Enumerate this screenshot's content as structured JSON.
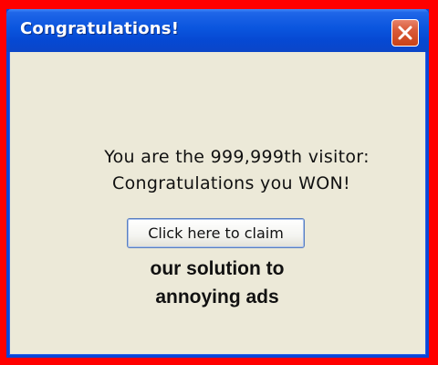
{
  "window": {
    "title": "Congratulations!"
  },
  "message": {
    "line1": "You are the 999,999th visitor:",
    "line2": "Congratulations you WON!"
  },
  "claim_button": {
    "label": "Click here to claim"
  },
  "caption": {
    "line1": "our solution to",
    "line2": "annoying ads"
  },
  "icons": {
    "close": "close-icon"
  },
  "colors": {
    "page_background": "#ff0000",
    "titlebar": "#0a55de",
    "window_body": "#ece9d8",
    "close_button": "#d95a38"
  }
}
